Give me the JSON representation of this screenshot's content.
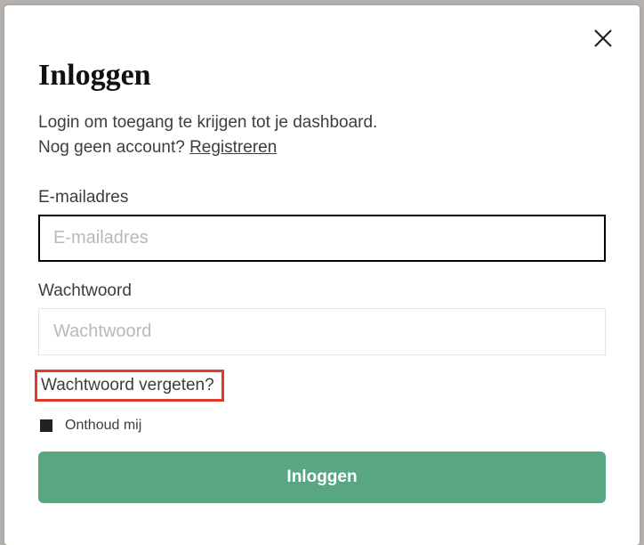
{
  "modal": {
    "title": "Inloggen",
    "subtitle_line1": "Login om toegang te krijgen tot je dashboard.",
    "subtitle_line2_prefix": "Nog geen account? ",
    "register_link": "Registreren"
  },
  "fields": {
    "email": {
      "label": "E-mailadres",
      "placeholder": "E-mailadres",
      "value": ""
    },
    "password": {
      "label": "Wachtwoord",
      "placeholder": "Wachtwoord",
      "value": ""
    }
  },
  "links": {
    "forgot_password": "Wachtwoord vergeten?"
  },
  "remember": {
    "label": "Onthoud mij",
    "checked": true
  },
  "actions": {
    "submit": "Inloggen"
  },
  "icons": {
    "close": "close-icon"
  }
}
